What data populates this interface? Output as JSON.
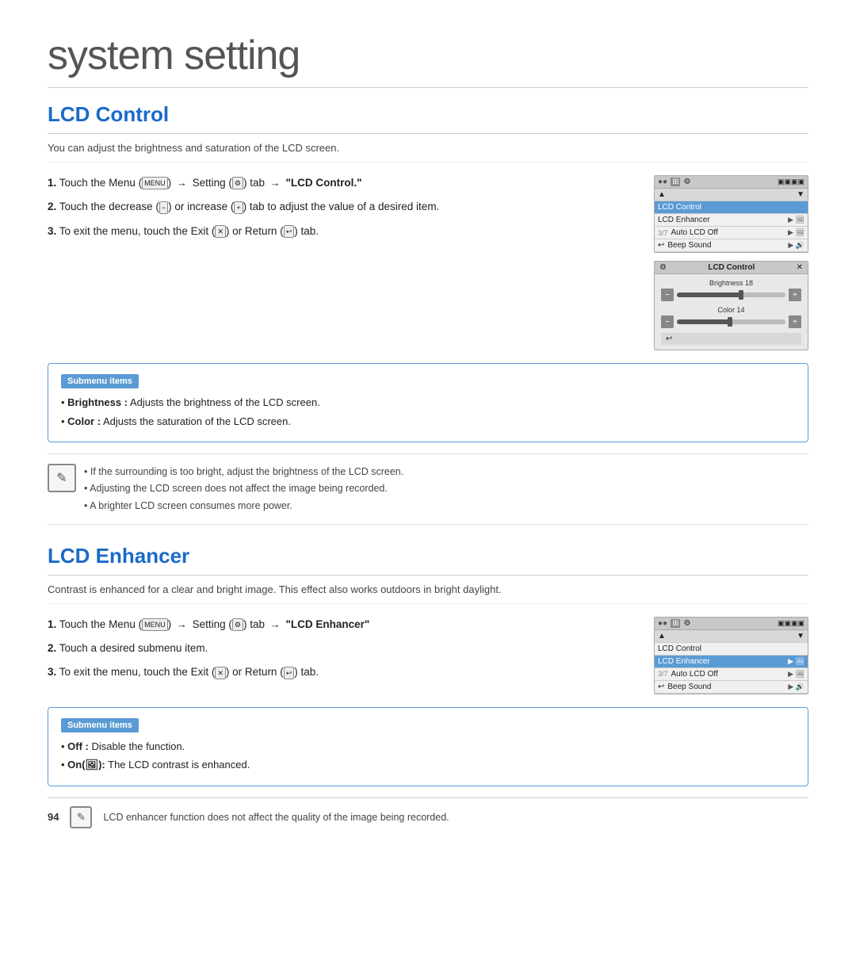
{
  "page": {
    "title": "system setting",
    "page_number": "94"
  },
  "lcd_control": {
    "section_title": "LCD Control",
    "description": "You can adjust the brightness and saturation of the LCD screen.",
    "steps": [
      {
        "num": "1.",
        "text_before": "Touch the Menu (",
        "menu_icon": "MENU",
        "text_mid": ") → Setting (",
        "setting_icon": "⚙",
        "text_after": ") tab → \"LCD Control.\""
      },
      {
        "num": "2.",
        "text": "Touch the decrease (−) or increase (+) tab to adjust the value of a desired item."
      },
      {
        "num": "3.",
        "text": "To exit the menu, touch the Exit (✕) or Return (↩) tab."
      }
    ],
    "submenu": {
      "title": "Submenu items",
      "items": [
        {
          "label": "Brightness :",
          "desc": "Adjusts the brightness of the LCD screen."
        },
        {
          "label": "Color :",
          "desc": "Adjusts the saturation of the LCD screen."
        }
      ]
    },
    "notes": [
      "If the surrounding is too bright, adjust the brightness of the LCD screen.",
      "Adjusting the LCD screen does not affect the image being recorded.",
      "A brighter LCD screen consumes more power."
    ],
    "mini_ui": {
      "rows": [
        {
          "label": "LCD Control",
          "highlight": true,
          "icon": ""
        },
        {
          "label": "LCD Enhancer",
          "highlight": false,
          "icon": "▶ 🖼"
        },
        {
          "label": "Auto LCD Off",
          "highlight": false,
          "icon": "▶ 🖼"
        },
        {
          "label": "Beep Sound",
          "highlight": false,
          "icon": "▶ 🔊"
        }
      ]
    },
    "mini_dialog": {
      "title": "LCD Control",
      "brightness_label": "Brightness 18",
      "color_label": "Color 14",
      "brightness_pct": 60,
      "color_pct": 50
    }
  },
  "lcd_enhancer": {
    "section_title": "LCD Enhancer",
    "description": "Contrast is enhanced for a clear and bright image. This effect also works outdoors in bright daylight.",
    "steps": [
      {
        "num": "1.",
        "text": "Touch the Menu (MENU) → Setting (⚙) tab → \"LCD Enhancer\""
      },
      {
        "num": "2.",
        "text": "Touch a desired submenu item."
      },
      {
        "num": "3.",
        "text": "To exit the menu, touch the Exit (✕) or Return (↩) tab."
      }
    ],
    "submenu": {
      "title": "Submenu items",
      "items": [
        {
          "label": "Off :",
          "desc": "Disable the function."
        },
        {
          "label": "On(🖼):",
          "desc": "The LCD contrast is enhanced."
        }
      ]
    },
    "mini_ui": {
      "rows": [
        {
          "label": "LCD Control",
          "highlight": false,
          "icon": ""
        },
        {
          "label": "LCD Enhancer",
          "highlight": true,
          "icon": "▶ 🖼"
        },
        {
          "label": "Auto LCD Off",
          "highlight": false,
          "icon": "▶ 🖼"
        },
        {
          "label": "Beep Sound",
          "highlight": false,
          "icon": "▶ 🔊"
        }
      ]
    },
    "footer_note": "LCD enhancer function does not affect the quality of the image being recorded."
  }
}
